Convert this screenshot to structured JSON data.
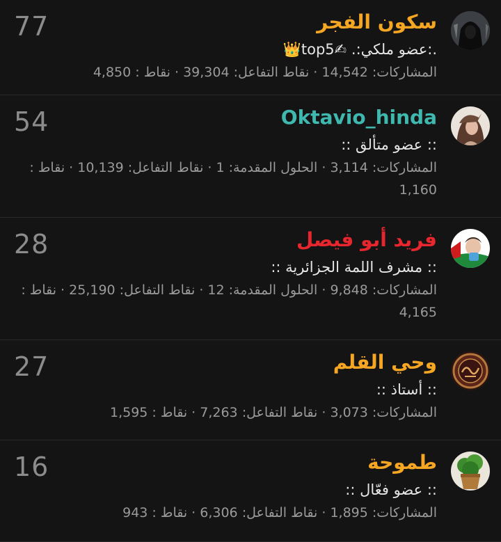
{
  "colors": {
    "background": "#141414",
    "name_orange": "#f5a623",
    "name_teal": "#3fb8af",
    "name_red": "#e8262e"
  },
  "members": [
    {
      "rank": "77",
      "name": "سكون الفجر",
      "title": ".:عضو ملكي:. ✍top5👑",
      "stats": "المشاركات: 14,542 · نقاط التفاعل: 39,304 · نقاط : 4,850",
      "avatar": "hooded-figure-avatar"
    },
    {
      "rank": "54",
      "name": "Oktavio_hinda",
      "title": ":: عضو متألق ::",
      "stats": "المشاركات: 3,114 · الحلول المقدمة: 1 · نقاط التفاعل: 10,139 · نقاط : 1,160",
      "avatar": "girl-avatar"
    },
    {
      "rank": "28",
      "name": "فريد أبو فيصل",
      "title": ":: مشرف اللمة الجزائرية ::",
      "stats": "المشاركات: 9,848 · الحلول المقدمة: 12 · نقاط التفاعل: 25,190 · نقاط : 4,165",
      "avatar": "baby-avatar"
    },
    {
      "rank": "27",
      "name": "وحي القلم",
      "title": ":: أستاذ ::",
      "stats": "المشاركات: 3,073 · نقاط التفاعل: 7,263 · نقاط : 1,595",
      "avatar": "calligraphy-avatar"
    },
    {
      "rank": "16",
      "name": "طموحة",
      "title": ":: عضو فعّال ::",
      "stats": "المشاركات: 1,895 · نقاط التفاعل: 6,306 · نقاط : 943",
      "avatar": "plant-avatar"
    }
  ]
}
